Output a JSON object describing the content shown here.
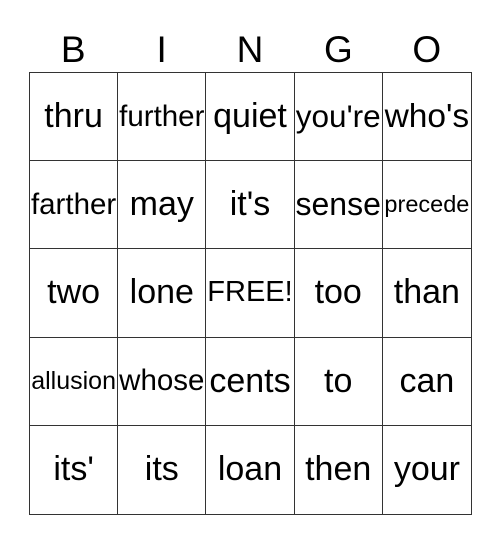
{
  "header": [
    "B",
    "I",
    "N",
    "G",
    "O"
  ],
  "cells": [
    [
      "thru",
      "further",
      "quiet",
      "you're",
      "who's"
    ],
    [
      "farther",
      "may",
      "it's",
      "sense",
      "precede"
    ],
    [
      "two",
      "lone",
      "FREE!",
      "too",
      "than"
    ],
    [
      "allusion",
      "whose",
      "cents",
      "to",
      "can"
    ],
    [
      "its'",
      "its",
      "loan",
      "then",
      "your"
    ]
  ]
}
